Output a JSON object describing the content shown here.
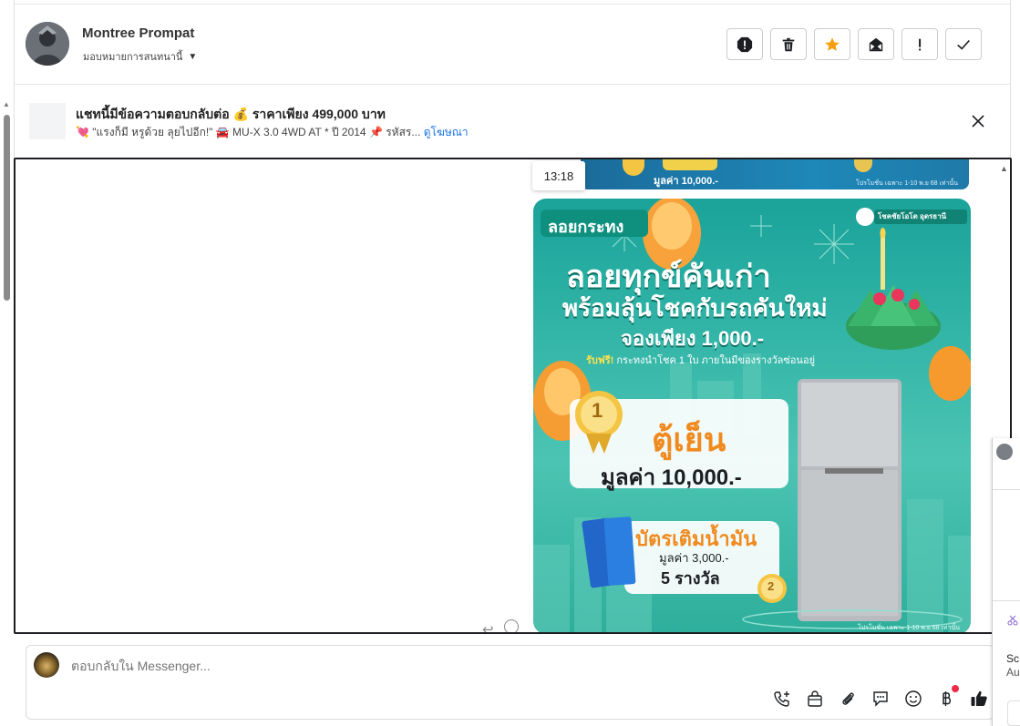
{
  "header": {
    "contact_name": "Montree Prompat",
    "assign_label": "มอบหมายการสนทนานี้",
    "toolbar": [
      {
        "name": "spam-button",
        "icon": "alert-octagon-icon"
      },
      {
        "name": "delete-button",
        "icon": "trash-icon"
      },
      {
        "name": "star-button",
        "icon": "star-icon"
      },
      {
        "name": "mark-unread-button",
        "icon": "envelope-icon"
      },
      {
        "name": "follow-up-button",
        "icon": "exclamation-icon"
      },
      {
        "name": "done-button",
        "icon": "check-icon"
      }
    ]
  },
  "ad_banner": {
    "title": "แชทนี้มีข้อความตอบกลับต่อ 💰 ราคาเพียง 499,000 บาท",
    "subtitle": "💘 \"แรงก็มี หรูด้วย ลุยไปอีก!\" 🚘 MU-X 3.0 4WD AT * ปี 2014 📌 รหัสร...",
    "link_label": "ดูโฆษณา"
  },
  "chat": {
    "timestamp": "13:18",
    "previous_image": {
      "prize_text": "มูลค่า 10,000.-",
      "note": "โปรโมชั่น เฉพาะ 1-10 พ.ย 68 เท่านั้น"
    },
    "promo_image": {
      "tag": "ลอยกระทง",
      "brand": "โชคชัยโอโต อุดรธานี",
      "headline1": "ลอยทุกข์คันเก่า",
      "headline2": "พร้อมลุ้นโชคกับรถคันใหม่",
      "deposit": "จองเพียง 1,000.-",
      "freebie_highlight": "รับฟรี!",
      "freebie_text": "กระทงนำโชค 1 ใบ ภายในมีของรางวัลซ่อนอยู่",
      "prize1_rank": "1",
      "prize1_name": "ตู้เย็น",
      "prize1_value": "มูลค่า 10,000.-",
      "prize2_rank": "2",
      "prize2_name": "บัตรเติมน้ำมัน",
      "prize2_value": "มูลค่า 3,000.-",
      "prize2_count": "5 รางวัล",
      "footnote": "โปรโมชั่น เฉพาะ 1-10 พ.ย 68 เท่านั้น"
    }
  },
  "composer": {
    "placeholder": "ตอบกลับใน Messenger..."
  },
  "peek_window": {
    "line1": "Sc",
    "line2": "Au"
  },
  "colors": {
    "accent": "#1a73e8",
    "star": "#f59e0b",
    "like": "#1c1e21",
    "notif": "#f02849",
    "promo_teal": "#2eae9c"
  }
}
